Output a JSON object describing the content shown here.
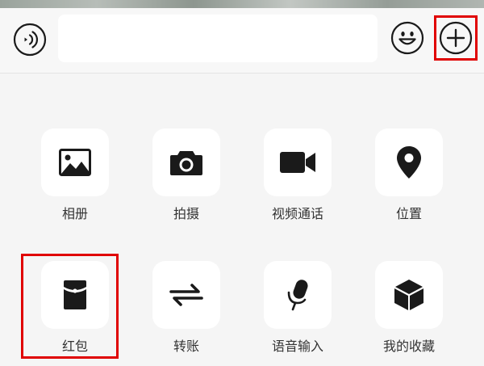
{
  "input": {
    "value": "",
    "placeholder": ""
  },
  "toolbar": {
    "voice_icon": "voice-icon",
    "emoji_icon": "emoji-icon",
    "plus_icon": "plus-icon"
  },
  "panel": {
    "items": [
      {
        "label": "相册",
        "icon": "photo-icon"
      },
      {
        "label": "拍摄",
        "icon": "camera-icon"
      },
      {
        "label": "视频通话",
        "icon": "video-call-icon"
      },
      {
        "label": "位置",
        "icon": "location-icon"
      },
      {
        "label": "红包",
        "icon": "red-packet-icon"
      },
      {
        "label": "转账",
        "icon": "transfer-icon"
      },
      {
        "label": "语音输入",
        "icon": "microphone-icon"
      },
      {
        "label": "我的收藏",
        "icon": "favorites-icon"
      }
    ]
  },
  "colors": {
    "highlight": "#e00000",
    "icon": "#1a1a1a",
    "tile": "#ffffff",
    "panel_bg": "#f5f5f5"
  }
}
